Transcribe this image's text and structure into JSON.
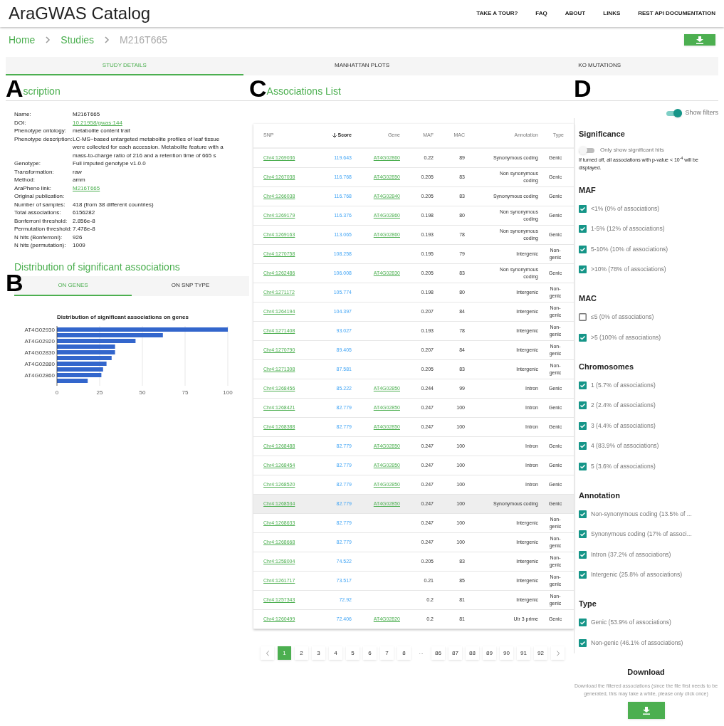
{
  "header": {
    "brand": "AraGWAS Catalog",
    "nav": [
      "TAKE A TOUR?",
      "FAQ",
      "ABOUT",
      "LINKS",
      "REST API DOCUMENTATION"
    ]
  },
  "breadcrumb": [
    {
      "label": "Home",
      "current": false
    },
    {
      "label": "Studies",
      "current": false
    },
    {
      "label": "M216T665",
      "current": true
    }
  ],
  "tabs": [
    {
      "label": "STUDY DETAILS",
      "selected": true
    },
    {
      "label": "MANHATTAN PLOTS",
      "selected": false
    },
    {
      "label": "KO MUTATIONS",
      "selected": false
    }
  ],
  "description": {
    "panel_label": "A",
    "title": "scription",
    "rows": [
      {
        "label": "Name:",
        "value": "M216T665",
        "kind": "text"
      },
      {
        "label": "DOI:",
        "value": "10.21958/gwas:144",
        "kind": "link"
      },
      {
        "label": "Phenotype ontology:",
        "value": "metabolite content trait",
        "kind": "text"
      },
      {
        "label": "Phenotype description:",
        "value": "LC-MS−based untargeted metabolite profiles of leaf tissue were collected for each accession. Metabolite feature with a mass-to-charge ratio of 216 and a retention time of 665 s",
        "kind": "text"
      },
      {
        "label": "Genotype:",
        "value": "Full imputed genotype v1.0.0",
        "kind": "text"
      },
      {
        "label": "Transformation:",
        "value": "raw",
        "kind": "text"
      },
      {
        "label": "Method:",
        "value": "amm",
        "kind": "text"
      },
      {
        "label": "AraPheno link:",
        "value": "M216T665",
        "kind": "link"
      },
      {
        "label": "Original publication:",
        "kind": "text"
      },
      {
        "label": "Number of samples:",
        "value": "418 (from 38 different countries)",
        "kind": "text"
      },
      {
        "label": "Total associations:",
        "value": "6156282",
        "kind": "text"
      },
      {
        "label": "Bonferroni threshold:",
        "value": "2.856e-8",
        "kind": "text"
      },
      {
        "label": "Permutation threshold:",
        "value": "7.478e-8",
        "kind": "text"
      },
      {
        "label": "N hits (Bonferroni):",
        "value": "926",
        "kind": "text"
      },
      {
        "label": "N hits (permutation):",
        "value": "1009",
        "kind": "text"
      }
    ]
  },
  "distribution": {
    "title": "Distribution of significant associations",
    "panel_label": "B",
    "tabs": [
      {
        "label": "ON GENES",
        "selected": true
      },
      {
        "label": "ON SNP TYPE",
        "selected": false
      }
    ],
    "chart_data": {
      "type": "bar",
      "orientation": "horizontal",
      "title": "Distribution of significant associations on genes",
      "categories": [
        "AT4G02930",
        null,
        "AT4G02920",
        null,
        "AT4G02830",
        null,
        "AT4G02880",
        null,
        "AT4G02860",
        null
      ],
      "values": [
        100,
        62,
        46,
        34,
        34,
        32,
        29,
        27,
        26,
        18
      ],
      "xlim": [
        0,
        100
      ],
      "xticks": [
        0,
        25,
        50,
        75,
        100
      ],
      "grid": true
    }
  },
  "associations": {
    "panel_label": "C",
    "title": "Associations List",
    "columns": [
      {
        "label": "SNP",
        "sorted": false
      },
      {
        "label": "Score",
        "sorted": true
      },
      {
        "label": "Gene",
        "sorted": false
      },
      {
        "label": "MAF",
        "sorted": false
      },
      {
        "label": "MAC",
        "sorted": false
      },
      {
        "label": "Annotation",
        "sorted": false
      },
      {
        "label": "Type",
        "sorted": false
      }
    ],
    "rows": [
      {
        "snp": "Chr4:1269036",
        "score": "119.643",
        "gene": "AT4G02860",
        "maf": "0.22",
        "mac": "89",
        "annotation": "Synonymous coding",
        "type": "Genic",
        "highlighted": false
      },
      {
        "snp": "Chr4:1267038",
        "score": "116.768",
        "gene": "AT4G02850",
        "maf": "0.205",
        "mac": "83",
        "annotation": "Non synonymous coding",
        "type": "Genic",
        "highlighted": false
      },
      {
        "snp": "Chr4:1266038",
        "score": "116.768",
        "gene": "AT4G02840",
        "maf": "0.205",
        "mac": "83",
        "annotation": "Synonymous coding",
        "type": "Genic",
        "highlighted": false
      },
      {
        "snp": "Chr4:1269179",
        "score": "116.376",
        "gene": "AT4G02860",
        "maf": "0.198",
        "mac": "80",
        "annotation": "Non synonymous coding",
        "type": "Genic",
        "highlighted": false
      },
      {
        "snp": "Chr4:1269163",
        "score": "113.065",
        "gene": "AT4G02860",
        "maf": "0.193",
        "mac": "78",
        "annotation": "Non synonymous coding",
        "type": "Genic",
        "highlighted": false
      },
      {
        "snp": "Chr4:1270758",
        "score": "108.258",
        "maf": "0.195",
        "mac": "79",
        "annotation": "Intergenic",
        "type": "Non-genic",
        "highlighted": false
      },
      {
        "snp": "Chr4:1262486",
        "score": "106.008",
        "gene": "AT4G02830",
        "maf": "0.205",
        "mac": "83",
        "annotation": "Non synonymous coding",
        "type": "Genic",
        "highlighted": false
      },
      {
        "snp": "Chr4:1271172",
        "score": "105.774",
        "maf": "0.198",
        "mac": "80",
        "annotation": "Intergenic",
        "type": "Non-genic",
        "highlighted": false
      },
      {
        "snp": "Chr4:1264194",
        "score": "104.397",
        "maf": "0.207",
        "mac": "84",
        "annotation": "Intergenic",
        "type": "Non-genic",
        "highlighted": false
      },
      {
        "snp": "Chr4:1271408",
        "score": "93.027",
        "maf": "0.193",
        "mac": "78",
        "annotation": "Intergenic",
        "type": "Non-genic",
        "highlighted": false
      },
      {
        "snp": "Chr4:1270790",
        "score": "89.405",
        "maf": "0.207",
        "mac": "84",
        "annotation": "Intergenic",
        "type": "Non-genic",
        "highlighted": false
      },
      {
        "snp": "Chr4:1271308",
        "score": "87.581",
        "maf": "0.205",
        "mac": "83",
        "annotation": "Intergenic",
        "type": "Non-genic",
        "highlighted": false
      },
      {
        "snp": "Chr4:1268456",
        "score": "85.222",
        "gene": "AT4G02850",
        "maf": "0.244",
        "mac": "99",
        "annotation": "Intron",
        "type": "Genic",
        "highlighted": false
      },
      {
        "snp": "Chr4:1268421",
        "score": "82.779",
        "gene": "AT4G02850",
        "maf": "0.247",
        "mac": "100",
        "annotation": "Intron",
        "type": "Genic",
        "highlighted": false
      },
      {
        "snp": "Chr4:1268388",
        "score": "82.779",
        "gene": "AT4G02850",
        "maf": "0.247",
        "mac": "100",
        "annotation": "Intron",
        "type": "Genic",
        "highlighted": false
      },
      {
        "snp": "Chr4:1268488",
        "score": "82.779",
        "gene": "AT4G02850",
        "maf": "0.247",
        "mac": "100",
        "annotation": "Intron",
        "type": "Genic",
        "highlighted": false
      },
      {
        "snp": "Chr4:1268454",
        "score": "82.779",
        "gene": "AT4G02850",
        "maf": "0.247",
        "mac": "100",
        "annotation": "Intron",
        "type": "Genic",
        "highlighted": false
      },
      {
        "snp": "Chr4:1268520",
        "score": "82.779",
        "gene": "AT4G02850",
        "maf": "0.247",
        "mac": "100",
        "annotation": "Intron",
        "type": "Genic",
        "highlighted": false
      },
      {
        "snp": "Chr4:1268534",
        "score": "82.779",
        "gene": "AT4G02850",
        "maf": "0.247",
        "mac": "100",
        "annotation": "Synonymous coding",
        "type": "Genic",
        "highlighted": true
      },
      {
        "snp": "Chr4:1268633",
        "score": "82.779",
        "maf": "0.247",
        "mac": "100",
        "annotation": "Intergenic",
        "type": "Non-genic",
        "highlighted": false
      },
      {
        "snp": "Chr4:1268668",
        "score": "82.779",
        "maf": "0.247",
        "mac": "100",
        "annotation": "Intergenic",
        "type": "Non-genic",
        "highlighted": false
      },
      {
        "snp": "Chr4:1258004",
        "score": "74.522",
        "maf": "0.205",
        "mac": "83",
        "annotation": "Intergenic",
        "type": "Non-genic",
        "highlighted": false
      },
      {
        "snp": "Chr4:1261717",
        "score": "73.517",
        "maf": "0.21",
        "mac": "85",
        "annotation": "Intergenic",
        "type": "Non-genic",
        "highlighted": false
      },
      {
        "snp": "Chr4:1257343",
        "score": "72.92",
        "maf": "0.2",
        "mac": "81",
        "annotation": "Intergenic",
        "type": "Non-genic",
        "highlighted": false
      },
      {
        "snp": "Chr4:1260499",
        "score": "72.406",
        "gene": "AT4G02820",
        "maf": "0.2",
        "mac": "81",
        "annotation": "Utr 3 prime",
        "type": "Genic",
        "highlighted": false
      }
    ],
    "pagination": [
      {
        "kind": "prev"
      },
      {
        "kind": "page",
        "label": "1",
        "selected": true
      },
      {
        "kind": "page",
        "label": "2",
        "selected": false
      },
      {
        "kind": "page",
        "label": "3",
        "selected": false
      },
      {
        "kind": "page",
        "label": "4",
        "selected": false
      },
      {
        "kind": "page",
        "label": "5",
        "selected": false
      },
      {
        "kind": "page",
        "label": "6",
        "selected": false
      },
      {
        "kind": "page",
        "label": "7",
        "selected": false
      },
      {
        "kind": "page",
        "label": "8",
        "selected": false
      },
      {
        "kind": "ellipsis",
        "label": "..."
      },
      {
        "kind": "page",
        "label": "86",
        "selected": false
      },
      {
        "kind": "page",
        "label": "87",
        "selected": false
      },
      {
        "kind": "page",
        "label": "88",
        "selected": false
      },
      {
        "kind": "page",
        "label": "89",
        "selected": false
      },
      {
        "kind": "page",
        "label": "90",
        "selected": false
      },
      {
        "kind": "page",
        "label": "91",
        "selected": false
      },
      {
        "kind": "page",
        "label": "92",
        "selected": false
      },
      {
        "kind": "next"
      }
    ]
  },
  "filters": {
    "panel_label": "D",
    "show_filters": {
      "label": "Show filters",
      "on": true
    },
    "significance": {
      "title": "Significance",
      "toggle_label": "Only show significant hits",
      "on": false,
      "note": "If turned off, all associations with p-value < 10$^{-4}$ will be displayed."
    },
    "groups": [
      {
        "title": "MAF",
        "options": [
          {
            "label": "<1% (0% of associations)",
            "checked": true
          },
          {
            "label": "1-5% (12% of associations)",
            "checked": true
          },
          {
            "label": "5-10% (10% of associations)",
            "checked": true
          },
          {
            "label": ">10% (78% of associations)",
            "checked": true
          }
        ]
      },
      {
        "title": "MAC",
        "options": [
          {
            "label": "≤5 (0% of associations)",
            "checked": false
          },
          {
            "label": ">5 (100% of associations)",
            "checked": true
          }
        ]
      },
      {
        "title": "Chromosomes",
        "options": [
          {
            "label": "1 (5.7% of associations)",
            "checked": true
          },
          {
            "label": "2 (2.4% of associations)",
            "checked": true
          },
          {
            "label": "3 (4.4% of associations)",
            "checked": true
          },
          {
            "label": "4 (83.9% of associations)",
            "checked": true
          },
          {
            "label": "5 (3.6% of associations)",
            "checked": true
          }
        ]
      },
      {
        "title": "Annotation",
        "options": [
          {
            "label": "Non-synonymous coding (13.5% of ...",
            "checked": true
          },
          {
            "label": "Synonymous coding (17% of associ...",
            "checked": true
          },
          {
            "label": "Intron (37.2% of associations)",
            "checked": true
          },
          {
            "label": "Intergenic (25.8% of associations)",
            "checked": true
          }
        ]
      },
      {
        "title": "Type",
        "options": [
          {
            "label": "Genic (53.9% of associations)",
            "checked": true
          },
          {
            "label": "Non-genic (46.1% of associations)",
            "checked": true
          }
        ]
      }
    ],
    "download": {
      "title": "Download",
      "text": "Download the filtered associations (since the file first needs to be generated, this may take a while, please only click once)"
    }
  }
}
